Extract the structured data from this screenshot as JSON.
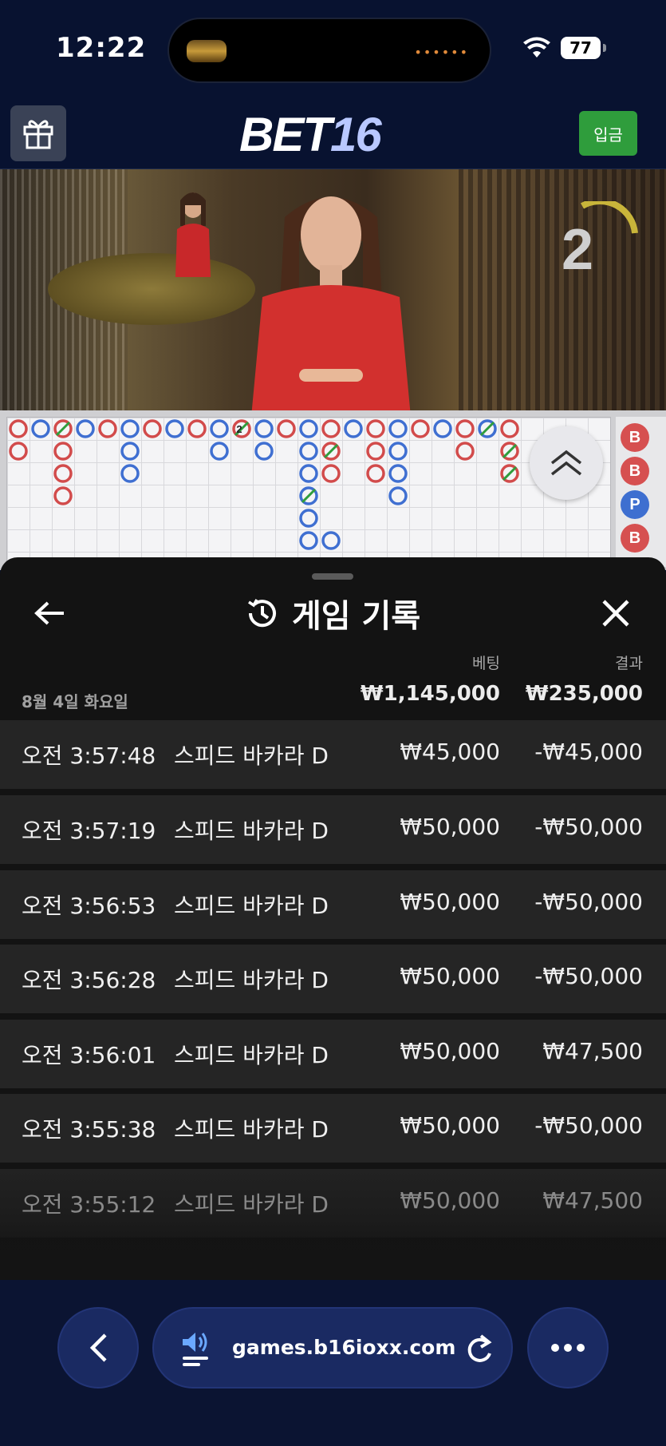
{
  "status_bar": {
    "time": "12:22",
    "battery": "77"
  },
  "header": {
    "logo_part1": "BET",
    "logo_part2": "16",
    "deposit_label": "입금"
  },
  "video": {
    "countdown": "2"
  },
  "roadmap": {
    "marker": "2",
    "side_labels": [
      "B",
      "B",
      "P",
      "B"
    ]
  },
  "panel": {
    "title": "게임 기록",
    "column_bet": "베팅",
    "column_result": "결과",
    "date": "8월 4일 화요일",
    "total_bet": "₩1,145,000",
    "total_result": "₩235,000",
    "rows": [
      {
        "time": "오전 3:57:48",
        "game": "스피드 바카라 D",
        "bet": "₩45,000",
        "result": "-₩45,000"
      },
      {
        "time": "오전 3:57:19",
        "game": "스피드 바카라 D",
        "bet": "₩50,000",
        "result": "-₩50,000"
      },
      {
        "time": "오전 3:56:53",
        "game": "스피드 바카라 D",
        "bet": "₩50,000",
        "result": "-₩50,000"
      },
      {
        "time": "오전 3:56:28",
        "game": "스피드 바카라 D",
        "bet": "₩50,000",
        "result": "-₩50,000"
      },
      {
        "time": "오전 3:56:01",
        "game": "스피드 바카라 D",
        "bet": "₩50,000",
        "result": "₩47,500"
      },
      {
        "time": "오전 3:55:38",
        "game": "스피드 바카라 D",
        "bet": "₩50,000",
        "result": "-₩50,000"
      },
      {
        "time": "오전 3:55:12",
        "game": "스피드 바카라 D",
        "bet": "₩50,000",
        "result": "₩47,500"
      }
    ]
  },
  "browser": {
    "url": "games.b16ioxx.com"
  },
  "colors": {
    "banker": "#d24b4b",
    "player": "#3f6fd1",
    "deposit": "#2f9d3c",
    "panel_bg": "#131313",
    "row_bg": "#252525"
  }
}
